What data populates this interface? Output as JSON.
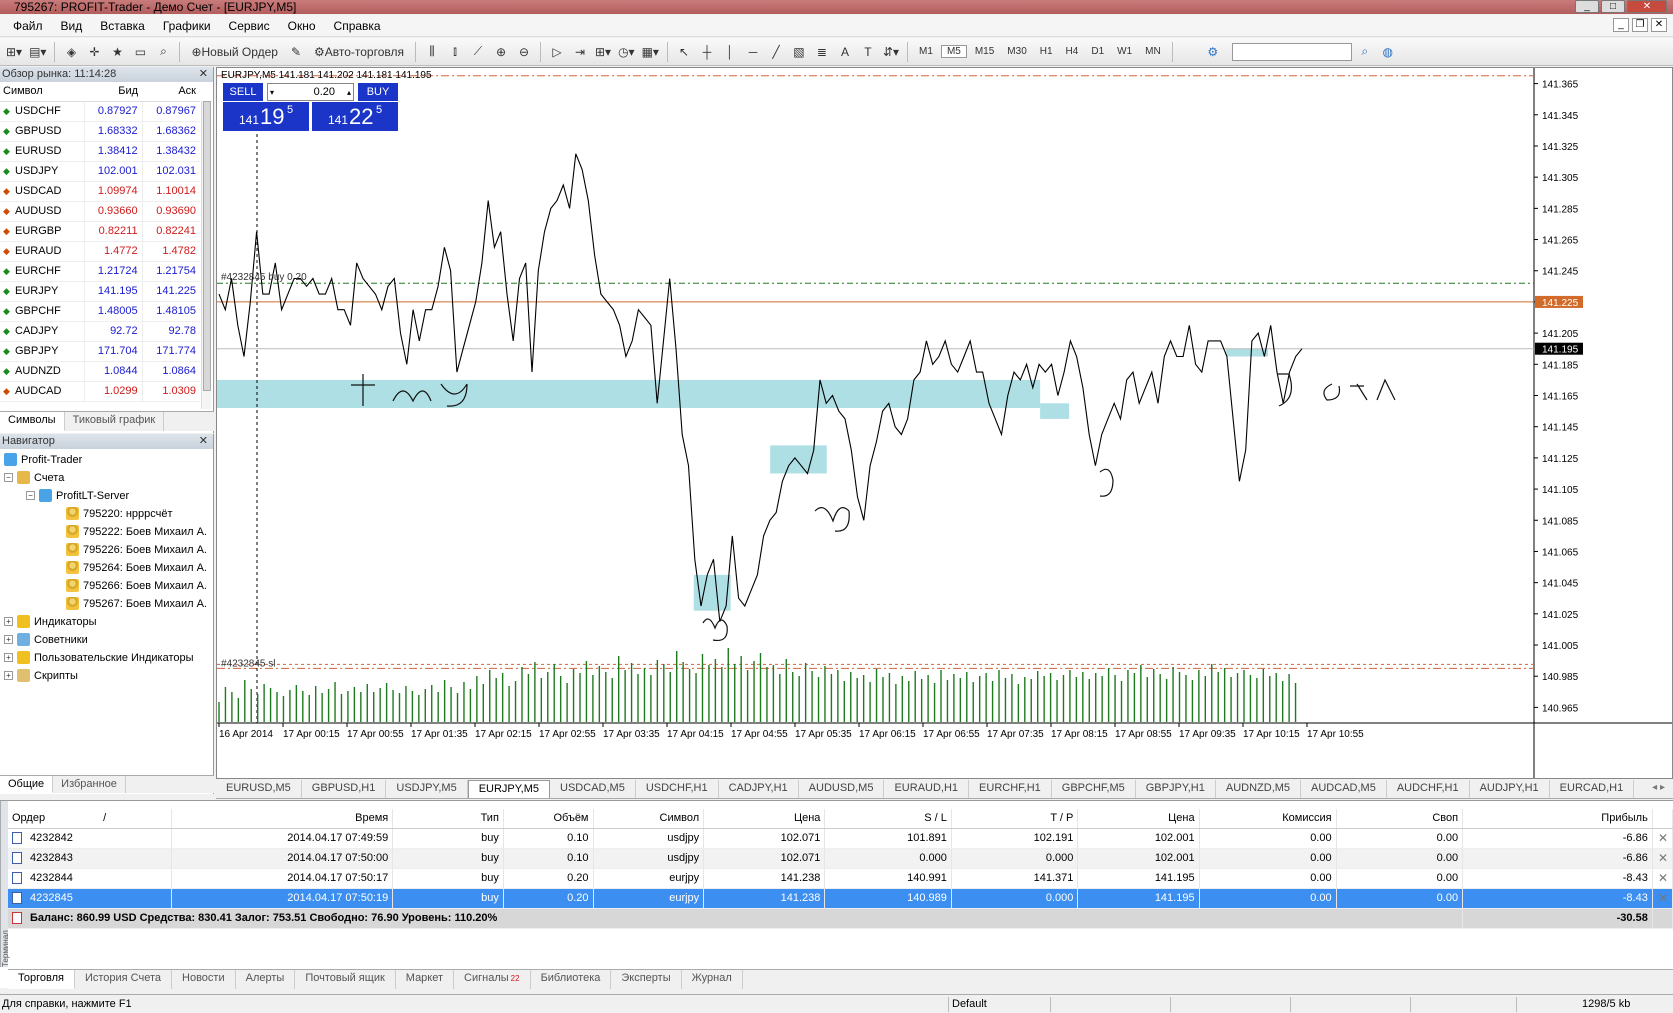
{
  "window": {
    "title": "795267: PROFIT-Trader - Демо Счет - [EURJPY,M5]"
  },
  "menu": [
    "Файл",
    "Вид",
    "Вставка",
    "Графики",
    "Сервис",
    "Окно",
    "Справка"
  ],
  "toolbar": {
    "new_order": "Новый Ордер",
    "auto_trading": "Авто-торговля",
    "text_tool": "A",
    "timeframes": [
      "M1",
      "M5",
      "M15",
      "M30",
      "H1",
      "H4",
      "D1",
      "W1",
      "MN"
    ],
    "active_timeframe": "M5"
  },
  "market_watch": {
    "title": "Обзор рынка: 11:14:28",
    "columns": [
      "Символ",
      "Бид",
      "Аск"
    ],
    "rows": [
      {
        "symbol": "USDCHF",
        "bid": "0.87927",
        "ask": "0.87967",
        "dir": "up"
      },
      {
        "symbol": "GBPUSD",
        "bid": "1.68332",
        "ask": "1.68362",
        "dir": "up"
      },
      {
        "symbol": "EURUSD",
        "bid": "1.38412",
        "ask": "1.38432",
        "dir": "up"
      },
      {
        "symbol": "USDJPY",
        "bid": "102.001",
        "ask": "102.031",
        "dir": "up"
      },
      {
        "symbol": "USDCAD",
        "bid": "1.09974",
        "ask": "1.10014",
        "dir": "down"
      },
      {
        "symbol": "AUDUSD",
        "bid": "0.93660",
        "ask": "0.93690",
        "dir": "down"
      },
      {
        "symbol": "EURGBP",
        "bid": "0.82211",
        "ask": "0.82241",
        "dir": "down"
      },
      {
        "symbol": "EURAUD",
        "bid": "1.4772",
        "ask": "1.4782",
        "dir": "down"
      },
      {
        "symbol": "EURCHF",
        "bid": "1.21724",
        "ask": "1.21754",
        "dir": "up"
      },
      {
        "symbol": "EURJPY",
        "bid": "141.195",
        "ask": "141.225",
        "dir": "up"
      },
      {
        "symbol": "GBPCHF",
        "bid": "1.48005",
        "ask": "1.48105",
        "dir": "up"
      },
      {
        "symbol": "CADJPY",
        "bid": "92.72",
        "ask": "92.78",
        "dir": "up"
      },
      {
        "symbol": "GBPJPY",
        "bid": "171.704",
        "ask": "171.774",
        "dir": "up"
      },
      {
        "symbol": "AUDNZD",
        "bid": "1.0844",
        "ask": "1.0864",
        "dir": "up"
      },
      {
        "symbol": "AUDCAD",
        "bid": "1.0299",
        "ask": "1.0309",
        "dir": "down"
      }
    ],
    "tabs": [
      "Символы",
      "Тиковый график"
    ]
  },
  "navigator": {
    "title": "Навигатор",
    "root": "Profit-Trader",
    "accounts_label": "Счета",
    "server": "ProfitLT-Server",
    "accounts": [
      "795220: нрррсчёт",
      "795222: Боев Михаил А.",
      "795226: Боев Михаил А.",
      "795264: Боев Михаил А.",
      "795266: Боев Михаил А.",
      "795267: Боев Михаил А."
    ],
    "indicators": "Индикаторы",
    "experts": "Советники",
    "custom_indicators": "Пользовательские Индикаторы",
    "scripts": "Скрипты",
    "tabs": [
      "Общие",
      "Избранное"
    ]
  },
  "chart": {
    "header": "EURJPY,M5  141.181 141.202 141.181 141.195",
    "one_click": {
      "sell": "SELL",
      "buy": "BUY",
      "volume": "0.20",
      "sell_price": {
        "prefix": "141",
        "big": "19",
        "sup": "5"
      },
      "buy_price": {
        "prefix": "141",
        "big": "22",
        "sup": "5"
      }
    },
    "order_label_buy": "#4232845 buy 0.20",
    "order_label_sl": "#4232845 sl",
    "price_ticks": [
      "141.365",
      "141.345",
      "141.325",
      "141.305",
      "141.285",
      "141.265",
      "141.245",
      "141.225",
      "141.205",
      "141.185",
      "141.165",
      "141.145",
      "141.125",
      "141.105",
      "141.085",
      "141.065",
      "141.045",
      "141.025",
      "141.005",
      "140.985",
      "140.965"
    ],
    "bid_label": "141.195",
    "ask_label": "141.225",
    "time_ticks": [
      "16 Apr 2014",
      "17 Apr 00:15",
      "17 Apr 00:55",
      "17 Apr 01:35",
      "17 Apr 02:15",
      "17 Apr 02:55",
      "17 Apr 03:35",
      "17 Apr 04:15",
      "17 Apr 04:55",
      "17 Apr 05:35",
      "17 Apr 06:15",
      "17 Apr 06:55",
      "17 Apr 07:35",
      "17 Apr 08:15",
      "17 Apr 08:55",
      "17 Apr 09:35",
      "17 Apr 10:15",
      "17 Apr 10:55"
    ],
    "colors": {
      "line": "#000000",
      "zone": "#a9dde3",
      "ask": "#d26a2a",
      "tp": "#1e7a1e",
      "sl": "#d2643c",
      "volume": "#1e7a1e",
      "bidbg": "#000000"
    },
    "series": [
      141.23,
      141.22,
      141.24,
      141.21,
      141.19,
      141.225,
      141.27,
      141.23,
      141.23,
      141.25,
      141.22,
      141.23,
      141.24,
      141.24,
      141.235,
      141.24,
      141.23,
      141.23,
      141.24,
      141.22,
      141.22,
      141.21,
      141.25,
      141.24,
      141.235,
      141.23,
      141.22,
      141.235,
      141.24,
      141.205,
      141.185,
      141.22,
      141.2,
      141.22,
      141.22,
      141.235,
      141.26,
      141.245,
      141.18,
      141.195,
      141.21,
      141.225,
      141.25,
      141.29,
      141.26,
      141.27,
      141.23,
      141.2,
      141.24,
      141.25,
      141.18,
      141.245,
      141.27,
      141.285,
      141.29,
      141.3,
      141.285,
      141.32,
      141.31,
      141.29,
      141.255,
      141.23,
      141.225,
      141.22,
      141.21,
      141.19,
      141.2,
      141.22,
      141.215,
      141.21,
      141.16,
      141.2,
      141.24,
      141.195,
      141.14,
      141.12,
      141.06,
      141.03,
      141.05,
      141.06,
      141.02,
      141.03,
      141.075,
      141.035,
      141.03,
      141.04,
      141.05,
      141.075,
      141.085,
      141.09,
      141.11,
      141.12,
      141.125,
      141.12,
      141.115,
      141.13,
      141.175,
      141.16,
      141.165,
      141.155,
      141.15,
      141.13,
      141.1,
      141.085,
      141.12,
      141.135,
      141.155,
      141.16,
      141.145,
      141.14,
      141.15,
      141.175,
      141.18,
      141.2,
      141.185,
      141.19,
      141.2,
      141.185,
      141.18,
      141.19,
      141.2,
      141.18,
      141.18,
      141.16,
      141.15,
      141.14,
      141.165,
      141.18,
      141.175,
      141.185,
      141.17,
      141.185,
      141.18,
      141.185,
      141.165,
      141.18,
      141.2,
      141.19,
      141.17,
      141.14,
      141.12,
      141.14,
      141.15,
      141.16,
      141.15,
      141.175,
      141.18,
      141.16,
      141.17,
      141.18,
      141.16,
      141.19,
      141.2,
      141.19,
      141.19,
      141.21,
      141.185,
      141.18,
      141.2,
      141.2,
      141.2,
      141.19,
      141.15,
      141.11,
      141.13,
      141.2,
      141.205,
      141.19,
      141.21,
      141.18,
      141.16,
      141.18,
      141.19,
      141.195
    ],
    "volumes": [
      20,
      35,
      30,
      24,
      42,
      33,
      28,
      38,
      34,
      30,
      26,
      32,
      37,
      31,
      27,
      36,
      29,
      33,
      40,
      28,
      31,
      35,
      30,
      38,
      30,
      34,
      39,
      32,
      29,
      36,
      31,
      27,
      33,
      37,
      30,
      42,
      35,
      29,
      40,
      33,
      46,
      38,
      52,
      44,
      49,
      36,
      41,
      55,
      48,
      60,
      44,
      50,
      58,
      46,
      39,
      53,
      49,
      61,
      47,
      56,
      50,
      44,
      66,
      52,
      59,
      48,
      54,
      47,
      62,
      58,
      50,
      71,
      60,
      53,
      49,
      68,
      57,
      63,
      55,
      74,
      58,
      66,
      52,
      61,
      69,
      55,
      57,
      48,
      63,
      50,
      46,
      59,
      51,
      45,
      56,
      48,
      52,
      41,
      50,
      44,
      47,
      40,
      53,
      45,
      49,
      38,
      46,
      41,
      51,
      43,
      47,
      39,
      52,
      42,
      48,
      44,
      50,
      40,
      46,
      49,
      41,
      52,
      44,
      48,
      38,
      45,
      43,
      51,
      46,
      49,
      42,
      47,
      52,
      45,
      50,
      43,
      49,
      46,
      54,
      47,
      41,
      52,
      49,
      57,
      45,
      53,
      48,
      43,
      55,
      50,
      47,
      42,
      52,
      46,
      58,
      50,
      54,
      45,
      49,
      52,
      47,
      44,
      53,
      46,
      49,
      41,
      48,
      39
    ],
    "zones": [
      {
        "t0": 0,
        "t1": 0.625,
        "p0": 141.157,
        "p1": 141.175
      },
      {
        "t0": 0.625,
        "t1": 0.647,
        "p0": 141.15,
        "p1": 141.16
      },
      {
        "t0": 0.42,
        "t1": 0.463,
        "p0": 141.115,
        "p1": 141.133
      },
      {
        "t0": 0.362,
        "t1": 0.39,
        "p0": 141.027,
        "p1": 141.05
      },
      {
        "t0": 0.766,
        "t1": 0.798,
        "p0": 141.19,
        "p1": 141.195
      }
    ],
    "levels": {
      "ask": 141.225,
      "bid": 141.195,
      "tp": 141.237,
      "sl": 140.99,
      "top": 141.37
    },
    "ylim": [
      140.955,
      141.375
    ]
  },
  "symbol_tabs": [
    "EURUSD,M5",
    "GBPUSD,H1",
    "USDJPY,M5",
    "EURJPY,M5",
    "USDCAD,M5",
    "USDCHF,H1",
    "CADJPY,H1",
    "AUDUSD,M5",
    "EURAUD,H1",
    "EURCHF,H1",
    "GBPCHF,M5",
    "GBPJPY,H1",
    "AUDNZD,M5",
    "AUDCAD,M5",
    "AUDCHF,H1",
    "AUDJPY,H1",
    "EURCAD,H1"
  ],
  "active_symbol_tab": "EURJPY,M5",
  "terminal": {
    "side_label": "Терминал",
    "columns": [
      "Ордер",
      "/",
      "Время",
      "Тип",
      "Объём",
      "Символ",
      "Цена",
      "S / L",
      "T / P",
      "Цена",
      "Комиссия",
      "Своп",
      "Прибыль"
    ],
    "orders": [
      {
        "id": "4232842",
        "time": "2014.04.17 07:49:59",
        "type": "buy",
        "volume": "0.10",
        "symbol": "usdjpy",
        "price": "102.071",
        "sl": "101.891",
        "tp": "102.191",
        "cur": "102.001",
        "comm": "0.00",
        "swap": "0.00",
        "profit": "-6.86"
      },
      {
        "id": "4232843",
        "time": "2014.04.17 07:50:00",
        "type": "buy",
        "volume": "0.10",
        "symbol": "usdjpy",
        "price": "102.071",
        "sl": "0.000",
        "tp": "0.000",
        "cur": "102.001",
        "comm": "0.00",
        "swap": "0.00",
        "profit": "-6.86"
      },
      {
        "id": "4232844",
        "time": "2014.04.17 07:50:17",
        "type": "buy",
        "volume": "0.20",
        "symbol": "eurjpy",
        "price": "141.238",
        "sl": "140.991",
        "tp": "141.371",
        "cur": "141.195",
        "comm": "0.00",
        "swap": "0.00",
        "profit": "-8.43"
      },
      {
        "id": "4232845",
        "time": "2014.04.17 07:50:19",
        "type": "buy",
        "volume": "0.20",
        "symbol": "eurjpy",
        "price": "141.238",
        "sl": "140.989",
        "tp": "0.000",
        "cur": "141.195",
        "comm": "0.00",
        "swap": "0.00",
        "profit": "-8.43"
      }
    ],
    "balance": "Баланс: 860.99 USD  Средства: 830.41  Залог: 753.51  Свободно: 76.90  Уровень: 110.20%",
    "total_profit": "-30.58",
    "tabs": [
      "Торговля",
      "История Счета",
      "Новости",
      "Алерты",
      "Почтовый ящик",
      "Маркет",
      "Сигналы",
      "Библиотека",
      "Эксперты",
      "Журнал"
    ],
    "signals_badge": "22"
  },
  "status": {
    "help": "Для справки, нажмите F1",
    "profile": "Default",
    "traffic": "1298/5 kb"
  }
}
